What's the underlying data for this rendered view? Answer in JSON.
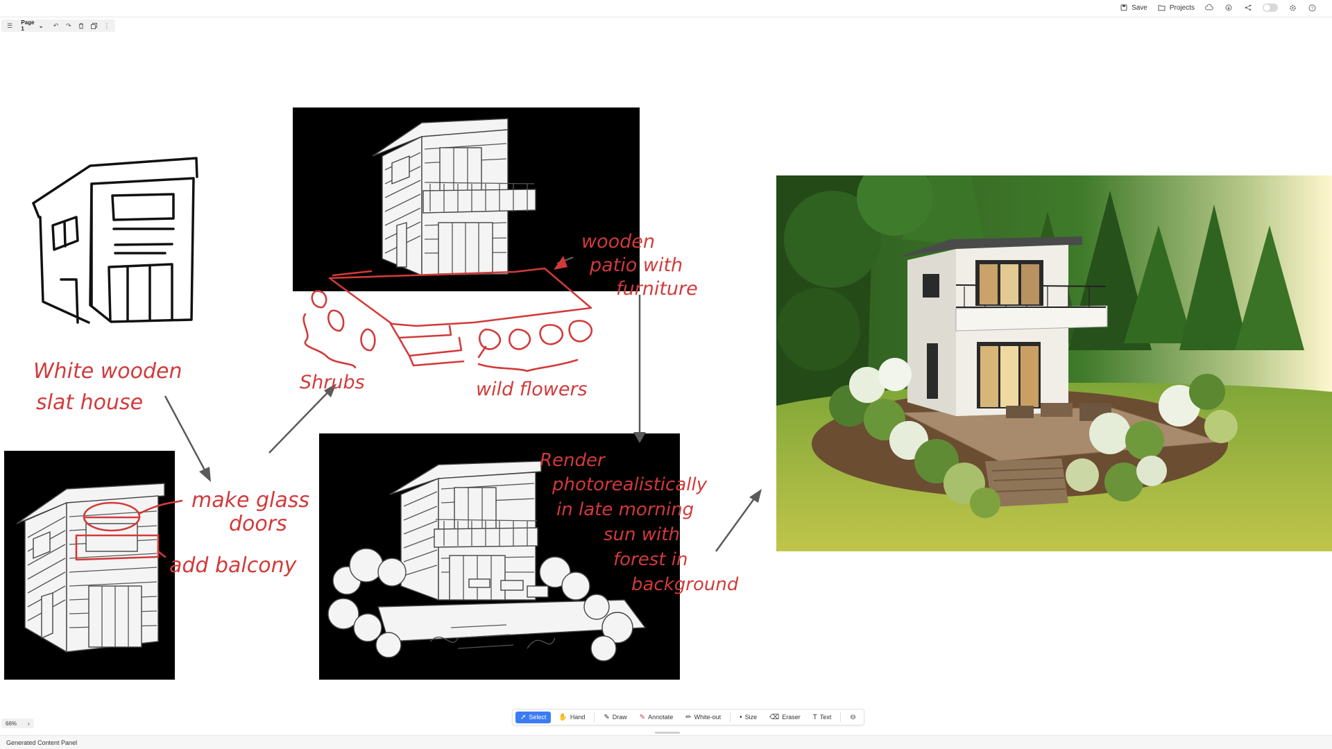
{
  "header": {
    "save_label": "Save",
    "projects_label": "Projects"
  },
  "pagebar": {
    "page_label": "Page 1"
  },
  "sketch": {
    "note1_line1": "White wooden",
    "note1_line2": "slat house",
    "note2_line1": "make glass",
    "note2_line2": "doors",
    "note3": "add balcony",
    "note4_line1": "wooden",
    "note4_line2": "patio with",
    "note4_line3": "furniture",
    "note5": "Shrubs",
    "note6": "wild flowers",
    "note7_line1": "Render",
    "note7_line2": "photorealistically",
    "note7_line3": "in late morning",
    "note7_line4": "sun with",
    "note7_line5": "forest in",
    "note7_line6": "background"
  },
  "toolbar": {
    "select_label": "Select",
    "hand_label": "Hand",
    "draw_label": "Draw",
    "annotate_label": "Annotate",
    "whiteout_label": "White-out",
    "size_label": "Size",
    "eraser_label": "Eraser",
    "text_label": "Text"
  },
  "zoom": {
    "level": "66%"
  },
  "footer": {
    "panel_label": "Generated Content Panel"
  },
  "colors": {
    "accent": "#3b7cf5",
    "annotation_red": "#d23a3a"
  }
}
